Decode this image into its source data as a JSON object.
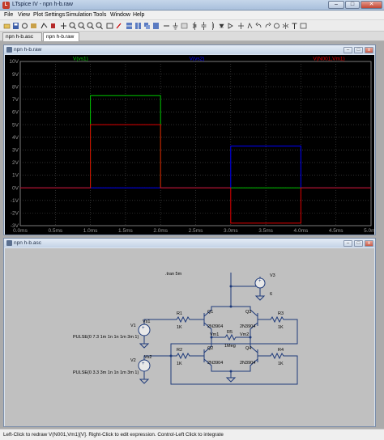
{
  "window": {
    "icon_letter": "L",
    "title": "LTspice IV - npn h-b.raw",
    "minimize": "–",
    "maximize": "□",
    "close": "✕"
  },
  "menu": [
    "File",
    "View",
    "Plot Settings",
    "Simulation",
    "Tools",
    "Window",
    "Help"
  ],
  "tabs": [
    {
      "label": "npn h-b.asc",
      "active": false
    },
    {
      "label": "npn h-b.raw",
      "active": true
    }
  ],
  "plot_window": {
    "title": "npn h-b.raw",
    "background": "#000000",
    "grid_color": "#4d4d4d",
    "axis_text_color": "#9a9a9a"
  },
  "chart_data": {
    "type": "line",
    "xlabel": "",
    "ylabel": "",
    "x_ticks": [
      "0.0ms",
      "0.5ms",
      "1.0ms",
      "1.5ms",
      "2.0ms",
      "2.5ms",
      "3.0ms",
      "3.5ms",
      "4.0ms",
      "4.5ms",
      "5.0ms"
    ],
    "y_ticks": [
      "10V",
      "9V",
      "8V",
      "7V",
      "6V",
      "5V",
      "4V",
      "3V",
      "2V",
      "1V",
      "0V",
      "-1V",
      "-2V",
      "-3V"
    ],
    "xlim": [
      0,
      5
    ],
    "ylim": [
      -3,
      10
    ],
    "grid": true,
    "series": [
      {
        "name": "V(vs1)",
        "color": "#00c800",
        "points": [
          [
            0,
            0
          ],
          [
            1.0,
            0
          ],
          [
            1.0,
            7.3
          ],
          [
            2.0,
            7.3
          ],
          [
            2.0,
            0
          ],
          [
            5.0,
            0
          ]
        ]
      },
      {
        "name": "V(vs2)",
        "color": "#0000ff",
        "points": [
          [
            0,
            0
          ],
          [
            3.0,
            0
          ],
          [
            3.0,
            3.3
          ],
          [
            4.0,
            3.3
          ],
          [
            4.0,
            0
          ],
          [
            5.0,
            0
          ]
        ]
      },
      {
        "name": "V(N001,Vm1)",
        "color": "#e00000",
        "points": [
          [
            0,
            0
          ],
          [
            1.0,
            0
          ],
          [
            1.0,
            5.0
          ],
          [
            2.0,
            5.0
          ],
          [
            2.0,
            0
          ],
          [
            3.0,
            0
          ],
          [
            3.0,
            -2.8
          ],
          [
            4.0,
            -2.8
          ],
          [
            4.0,
            0
          ],
          [
            5.0,
            0
          ]
        ]
      }
    ]
  },
  "schematic_window": {
    "title": "npn h-b.asc",
    "directive": ".tran 5m",
    "labels": {
      "v1": "V1",
      "v2": "V2",
      "v3": "V3",
      "v3_value": "6",
      "vs1": "Vs1",
      "vs2": "Vs2",
      "r1": "R1",
      "r1_value": "1K",
      "r2": "R2",
      "r2_value": "1K",
      "r3": "R3",
      "r3_value": "1K",
      "r4": "R4",
      "r4_value": "1K",
      "r5": "R5",
      "r5_value": "1Meg",
      "q1": "Q1",
      "q2": "Q2",
      "q3": "Q3",
      "q4": "Q4",
      "transistor_model": "2N3904",
      "vm1": "Vm1",
      "vm2": "Vm2",
      "pulse1": "PULSE(0 7.3 1m 1n 1n 1m 3m 1)",
      "pulse2": "PULSE(0 3.3 3m 1n 1n 1m 3m 1)"
    }
  },
  "status": "Left-Click to redraw V(N001,Vm1)[V].  Right-Click to edit expression.  Control-Left Click to integrate"
}
